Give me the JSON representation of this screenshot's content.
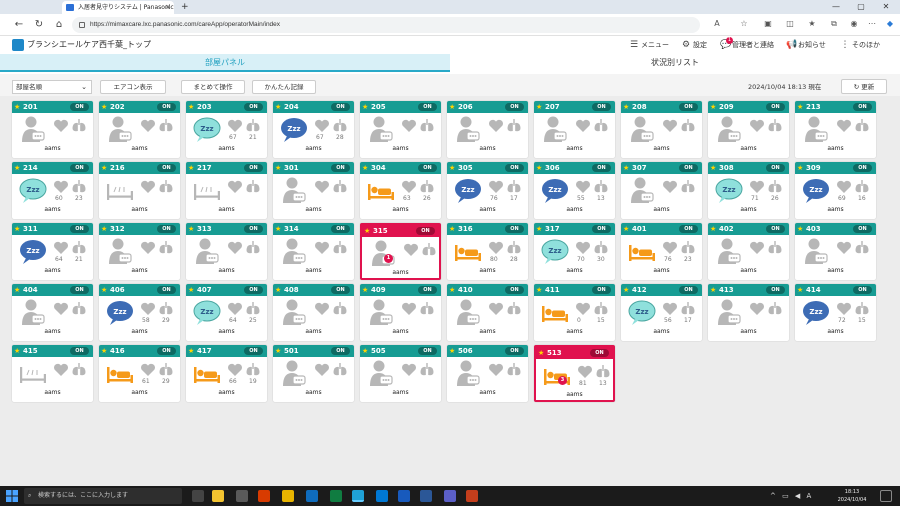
{
  "browser": {
    "tab_title": "入居者見守りシステム | Panasonic",
    "url": "https://mimaxcare.lxc.panasonic.com/careApp/operatorMain/index"
  },
  "app": {
    "title": "ブランシエールケア西千葉_トップ",
    "menu_label": "メニュー",
    "settings_label": "設定",
    "contact_label": "管理者と連絡",
    "contact_badge": "1",
    "notice_label": "お知らせ",
    "more_label": "そのほか"
  },
  "tabs": {
    "panel": "部屋パネル",
    "status_list": "状況別リスト"
  },
  "toolbar": {
    "sort_value": "部屋名順",
    "aircon_button": "エアコン表示",
    "batch_button": "まとめて操作",
    "easy_record_button": "かんたん記録",
    "timestamp": "2024/10/04 18:13 現在",
    "refresh_button": "更新"
  },
  "colors": {
    "header_teal": "#179c93",
    "alert_red": "#e0124e",
    "tab_active": "#29a9c8",
    "sleep_dark": "#3d6cb5",
    "sleep_light": "#8fe0dc",
    "in_bed_orange": "#f59a1a"
  },
  "rooms": [
    {
      "room": "201",
      "toggle": "ON",
      "status": "empty",
      "heart": "",
      "resp": "",
      "name": "aams"
    },
    {
      "room": "202",
      "toggle": "ON",
      "status": "empty",
      "heart": "",
      "resp": "",
      "name": "aams"
    },
    {
      "room": "203",
      "toggle": "ON",
      "status": "sleep-light",
      "heart": "67",
      "resp": "21",
      "name": "aams"
    },
    {
      "room": "204",
      "toggle": "ON",
      "status": "sleep-dark",
      "heart": "67",
      "resp": "28",
      "name": "aams"
    },
    {
      "room": "205",
      "toggle": "ON",
      "status": "empty",
      "heart": "",
      "resp": "",
      "name": "aams"
    },
    {
      "room": "206",
      "toggle": "ON",
      "status": "empty",
      "heart": "",
      "resp": "",
      "name": "aams"
    },
    {
      "room": "207",
      "toggle": "ON",
      "status": "empty",
      "heart": "",
      "resp": "",
      "name": "aams"
    },
    {
      "room": "208",
      "toggle": "ON",
      "status": "empty",
      "heart": "",
      "resp": "",
      "name": "aams"
    },
    {
      "room": "209",
      "toggle": "ON",
      "status": "empty",
      "heart": "",
      "resp": "",
      "name": "aams"
    },
    {
      "room": "213",
      "toggle": "ON",
      "status": "empty",
      "heart": "",
      "resp": "",
      "name": "aams"
    },
    {
      "room": "214",
      "toggle": "ON",
      "status": "sleep-light",
      "heart": "60",
      "resp": "23",
      "name": "aams"
    },
    {
      "room": "216",
      "toggle": "ON",
      "status": "bed-empty",
      "heart": "",
      "resp": "",
      "name": "aams"
    },
    {
      "room": "217",
      "toggle": "ON",
      "status": "bed-empty",
      "heart": "",
      "resp": "",
      "name": "aams"
    },
    {
      "room": "301",
      "toggle": "ON",
      "status": "empty",
      "heart": "",
      "resp": "",
      "name": "aams"
    },
    {
      "room": "304",
      "toggle": "ON",
      "status": "in-bed",
      "heart": "63",
      "resp": "26",
      "name": "aams"
    },
    {
      "room": "305",
      "toggle": "ON",
      "status": "sleep-dark",
      "heart": "76",
      "resp": "17",
      "name": "aams"
    },
    {
      "room": "306",
      "toggle": "ON",
      "status": "sleep-dark",
      "heart": "55",
      "resp": "13",
      "name": "aams"
    },
    {
      "room": "307",
      "toggle": "ON",
      "status": "empty",
      "heart": "",
      "resp": "",
      "name": "aams"
    },
    {
      "room": "308",
      "toggle": "ON",
      "status": "sleep-light",
      "heart": "71",
      "resp": "26",
      "name": "aams"
    },
    {
      "room": "309",
      "toggle": "ON",
      "status": "sleep-dark",
      "heart": "69",
      "resp": "16",
      "name": "aams"
    },
    {
      "room": "311",
      "toggle": "ON",
      "status": "sleep-dark",
      "heart": "64",
      "resp": "21",
      "name": "aams"
    },
    {
      "room": "312",
      "toggle": "ON",
      "status": "empty",
      "heart": "",
      "resp": "",
      "name": "aams"
    },
    {
      "room": "313",
      "toggle": "ON",
      "status": "empty",
      "heart": "",
      "resp": "",
      "name": "aams"
    },
    {
      "room": "314",
      "toggle": "ON",
      "status": "empty",
      "heart": "",
      "resp": "",
      "name": "aams"
    },
    {
      "room": "315",
      "toggle": "ON",
      "status": "empty",
      "heart": "",
      "resp": "",
      "name": "aams",
      "alert": true,
      "badge": "1"
    },
    {
      "room": "316",
      "toggle": "ON",
      "status": "in-bed",
      "heart": "80",
      "resp": "28",
      "name": "aams"
    },
    {
      "room": "317",
      "toggle": "ON",
      "status": "sleep-light",
      "heart": "70",
      "resp": "30",
      "name": "aams"
    },
    {
      "room": "401",
      "toggle": "ON",
      "status": "in-bed",
      "heart": "76",
      "resp": "23",
      "name": "aams"
    },
    {
      "room": "402",
      "toggle": "ON",
      "status": "empty",
      "heart": "",
      "resp": "",
      "name": "aams"
    },
    {
      "room": "403",
      "toggle": "ON",
      "status": "empty",
      "heart": "",
      "resp": "",
      "name": "aams"
    },
    {
      "room": "404",
      "toggle": "ON",
      "status": "empty",
      "heart": "",
      "resp": "",
      "name": "aams"
    },
    {
      "room": "406",
      "toggle": "ON",
      "status": "sleep-dark",
      "heart": "58",
      "resp": "29",
      "name": "aams"
    },
    {
      "room": "407",
      "toggle": "ON",
      "status": "sleep-light",
      "heart": "64",
      "resp": "25",
      "name": "aams"
    },
    {
      "room": "408",
      "toggle": "ON",
      "status": "empty",
      "heart": "",
      "resp": "",
      "name": "aams"
    },
    {
      "room": "409",
      "toggle": "ON",
      "status": "empty",
      "heart": "",
      "resp": "",
      "name": "aams"
    },
    {
      "room": "410",
      "toggle": "ON",
      "status": "empty",
      "heart": "",
      "resp": "",
      "name": "aams"
    },
    {
      "room": "411",
      "toggle": "ON",
      "status": "in-bed",
      "heart": "0",
      "resp": "15",
      "name": "aams"
    },
    {
      "room": "412",
      "toggle": "ON",
      "status": "sleep-light",
      "heart": "56",
      "resp": "17",
      "name": "aams"
    },
    {
      "room": "413",
      "toggle": "ON",
      "status": "empty",
      "heart": "",
      "resp": "",
      "name": "aams"
    },
    {
      "room": "414",
      "toggle": "ON",
      "status": "sleep-dark",
      "heart": "72",
      "resp": "15",
      "name": "aams"
    },
    {
      "room": "415",
      "toggle": "ON",
      "status": "bed-empty",
      "heart": "",
      "resp": "",
      "name": "aams"
    },
    {
      "room": "416",
      "toggle": "ON",
      "status": "in-bed",
      "heart": "61",
      "resp": "29",
      "name": "aams"
    },
    {
      "room": "417",
      "toggle": "ON",
      "status": "in-bed",
      "heart": "66",
      "resp": "19",
      "name": "aams"
    },
    {
      "room": "501",
      "toggle": "ON",
      "status": "empty",
      "heart": "",
      "resp": "",
      "name": "aams"
    },
    {
      "room": "505",
      "toggle": "ON",
      "status": "empty",
      "heart": "",
      "resp": "",
      "name": "aams"
    },
    {
      "room": "506",
      "toggle": "ON",
      "status": "empty",
      "heart": "",
      "resp": "",
      "name": "aams"
    },
    {
      "room": "513",
      "toggle": "ON",
      "status": "in-bed",
      "heart": "81",
      "resp": "13",
      "name": "aams",
      "alert": true,
      "badge": "3"
    }
  ],
  "taskbar": {
    "search_placeholder": "検索するには、ここに入力します",
    "time": "18:13",
    "date": "2024/10/04"
  }
}
